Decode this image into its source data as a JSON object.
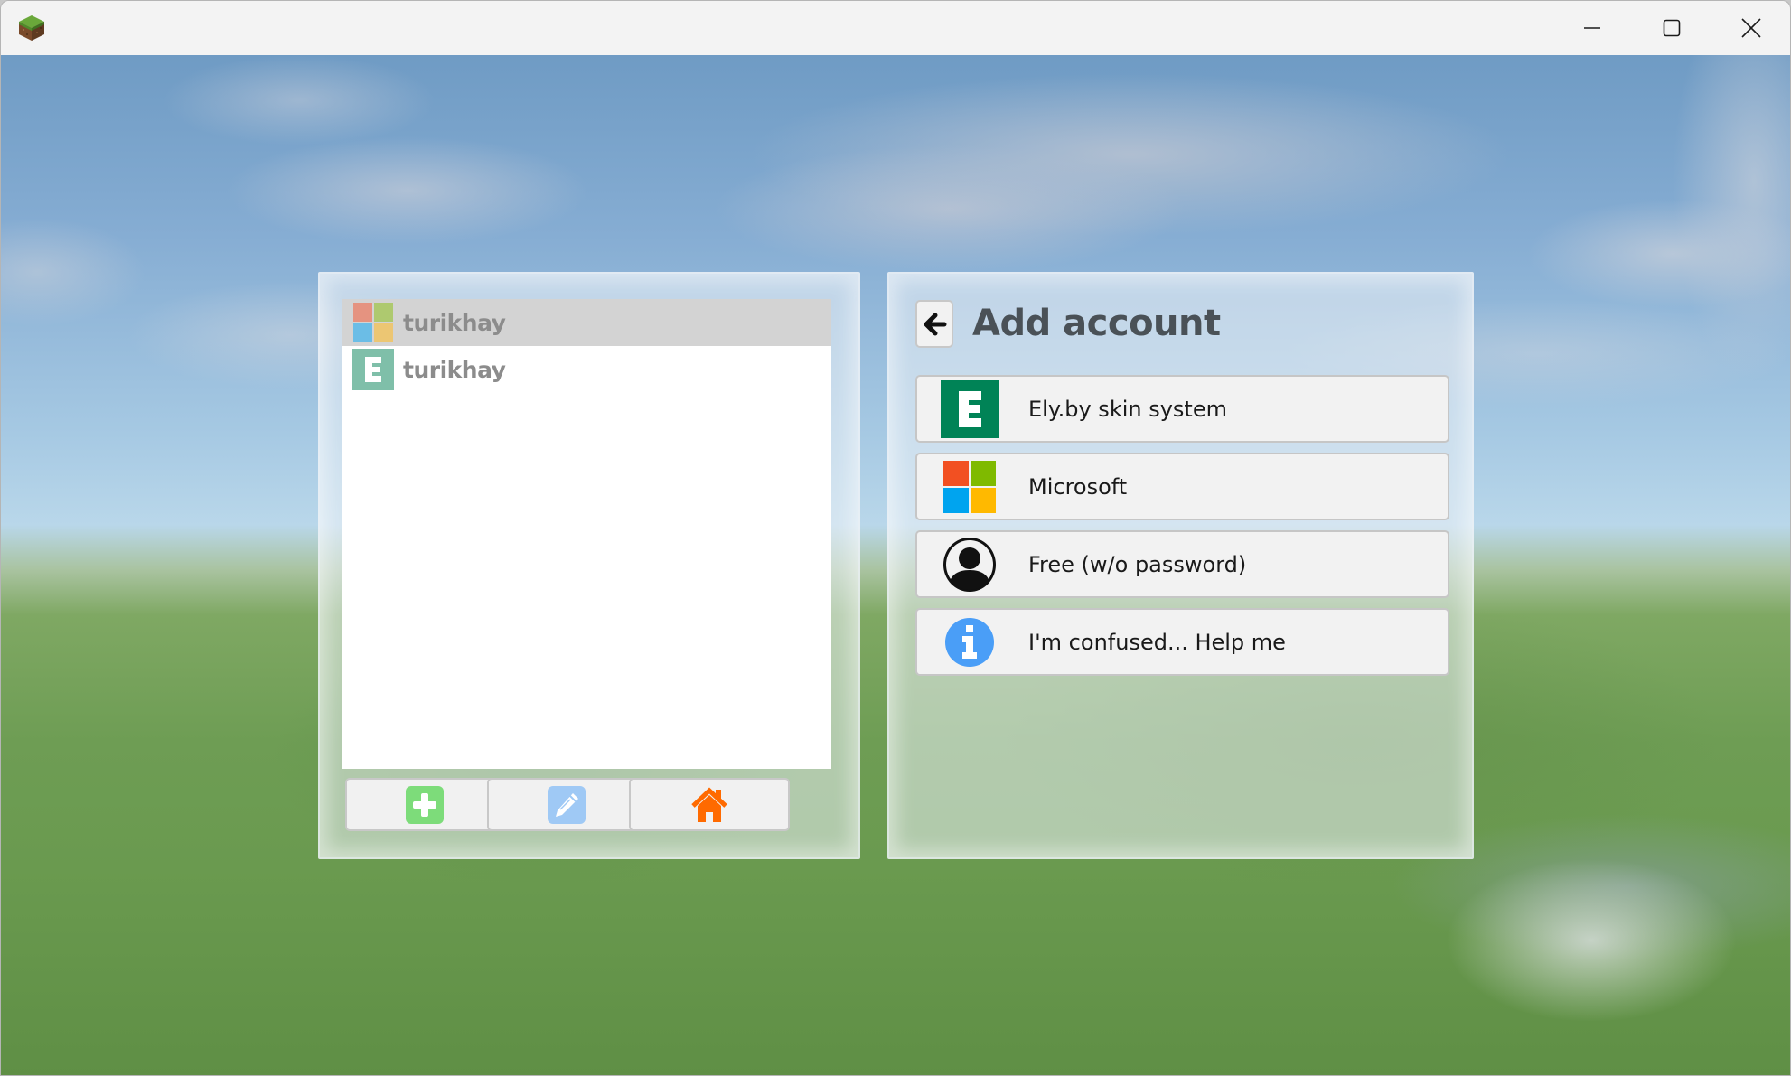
{
  "window": {
    "app_icon": "grass-block-icon",
    "controls": {
      "minimize": "minimize-icon",
      "maximize": "maximize-icon",
      "close": "close-icon"
    }
  },
  "accounts_panel": {
    "accounts": [
      {
        "name": "turikhay",
        "type": "microsoft",
        "icon": "microsoft-logo-icon",
        "selected": true
      },
      {
        "name": "turikhay",
        "type": "ely.by",
        "icon": "ely-by-icon",
        "selected": false
      }
    ],
    "toolbar": [
      {
        "icon": "add-icon",
        "action": "add",
        "color": "#7ddc7a"
      },
      {
        "icon": "pencil-icon",
        "action": "edit",
        "color": "#9fc9f5"
      },
      {
        "icon": "home-icon",
        "action": "home",
        "color": "#ff6a00"
      }
    ]
  },
  "add_account_panel": {
    "title": "Add account",
    "back_icon": "arrow-left-icon",
    "methods": [
      {
        "label": "Ely.by skin system",
        "icon": "ely-by-icon",
        "color": "#008356"
      },
      {
        "label": "Microsoft",
        "icon": "microsoft-logo-icon"
      },
      {
        "label": "Free (w/o password)",
        "icon": "user-circle-icon",
        "color": "#111111"
      },
      {
        "label": "I'm confused... Help me",
        "icon": "info-icon",
        "color": "#4a9ef7"
      }
    ]
  },
  "colors": {
    "microsoft": [
      "#f25022",
      "#7fba00",
      "#00a4ef",
      "#ffb900"
    ],
    "microsoft_faded": [
      "#e59380",
      "#aec96f",
      "#6bbde6",
      "#ecc673"
    ],
    "ely_faded": "#7fbfa9",
    "ely": "#008356"
  }
}
